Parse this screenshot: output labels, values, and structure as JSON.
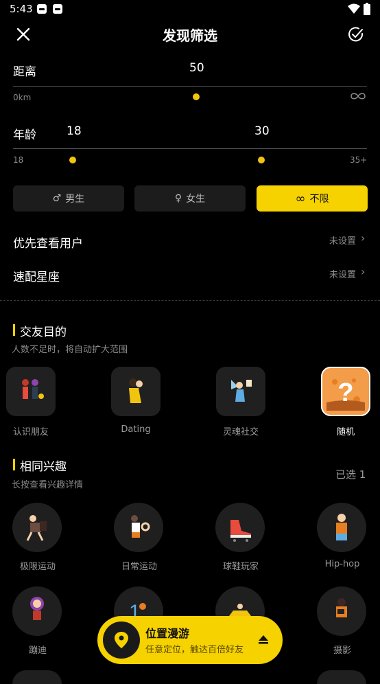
{
  "status_bar": {
    "time": "5:43"
  },
  "header": {
    "title": "发现筛选"
  },
  "distance": {
    "label": "距离",
    "value": "50",
    "min_label": "0km",
    "max_label": "∞",
    "level": 0.5
  },
  "age": {
    "label": "年龄",
    "low": "18",
    "high": "30",
    "min_label": "18",
    "max_label": "35+"
  },
  "gender": {
    "options": [
      {
        "symbol": "♂",
        "label": "男生"
      },
      {
        "symbol": "♀",
        "label": "女生"
      },
      {
        "symbol": "∞",
        "label": "不限"
      }
    ],
    "selected": "不限"
  },
  "settings": [
    {
      "label": "优先查看用户",
      "value": "未设置"
    },
    {
      "label": "速配星座",
      "value": "未设置"
    }
  ],
  "purpose": {
    "title": "交友目的",
    "subtitle": "人数不足时，将自动扩大范围",
    "items": [
      {
        "label": "认识朋友"
      },
      {
        "label": "Dating"
      },
      {
        "label": "灵魂社交"
      },
      {
        "label": "随机"
      }
    ],
    "selected": "随机"
  },
  "interests": {
    "title": "相同兴趣",
    "subtitle": "长按查看兴趣详情",
    "selected_count": "已选 1",
    "items": [
      {
        "label": "极限运动"
      },
      {
        "label": "日常运动"
      },
      {
        "label": "球鞋玩家"
      },
      {
        "label": "Hip-hop"
      },
      {
        "label": "蹦迪"
      },
      {
        "label": ""
      },
      {
        "label": ""
      },
      {
        "label": "摄影"
      }
    ]
  },
  "roam_banner": {
    "title": "位置漫游",
    "subtitle": "任意定位，触达百倍好友"
  },
  "colors": {
    "accent": "#f5d200",
    "background": "#000000",
    "card": "#1c1c1c"
  }
}
